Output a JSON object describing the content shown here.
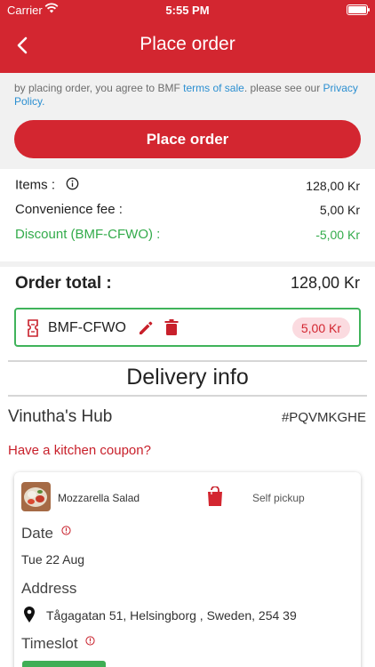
{
  "status_bar": {
    "carrier": "Carrier",
    "time": "5:55 PM"
  },
  "header": {
    "title": "Place order"
  },
  "agreement": {
    "prefix": "by placing order, you agree to BMF ",
    "terms_link": "terms of sale",
    "middle": ". please see our ",
    "privacy_link": "Privacy Policy",
    "suffix": "."
  },
  "place_order_button": "Place order",
  "summary": {
    "items_label": "Items :",
    "items_value": "128,00 Kr",
    "fee_label": "Convenience fee :",
    "fee_value": "5,00 Kr",
    "discount_label": "Discount (BMF-CFWO) :",
    "discount_value": "-5,00 Kr"
  },
  "total": {
    "label": "Order total :",
    "value": "128,00 Kr"
  },
  "coupon": {
    "code": "BMF-CFWO",
    "amount": "5,00 Kr"
  },
  "delivery": {
    "title": "Delivery info",
    "hub_name": "Vinutha's Hub",
    "hub_code": "#PQVMKGHE",
    "kitchen_coupon": "Have a kitchen coupon?"
  },
  "order_card": {
    "item_name": "Mozzarella Salad",
    "pickup": "Self pickup",
    "date_label": "Date",
    "date_value": "Tue 22 Aug",
    "address_label": "Address",
    "address_value": "Tågagatan 51, Helsingborg , Sweden, 254 39",
    "timeslot_label": "Timeslot"
  },
  "colors": {
    "brand": "#d32630",
    "success": "#33ab4b",
    "link": "#2b8fd1"
  }
}
